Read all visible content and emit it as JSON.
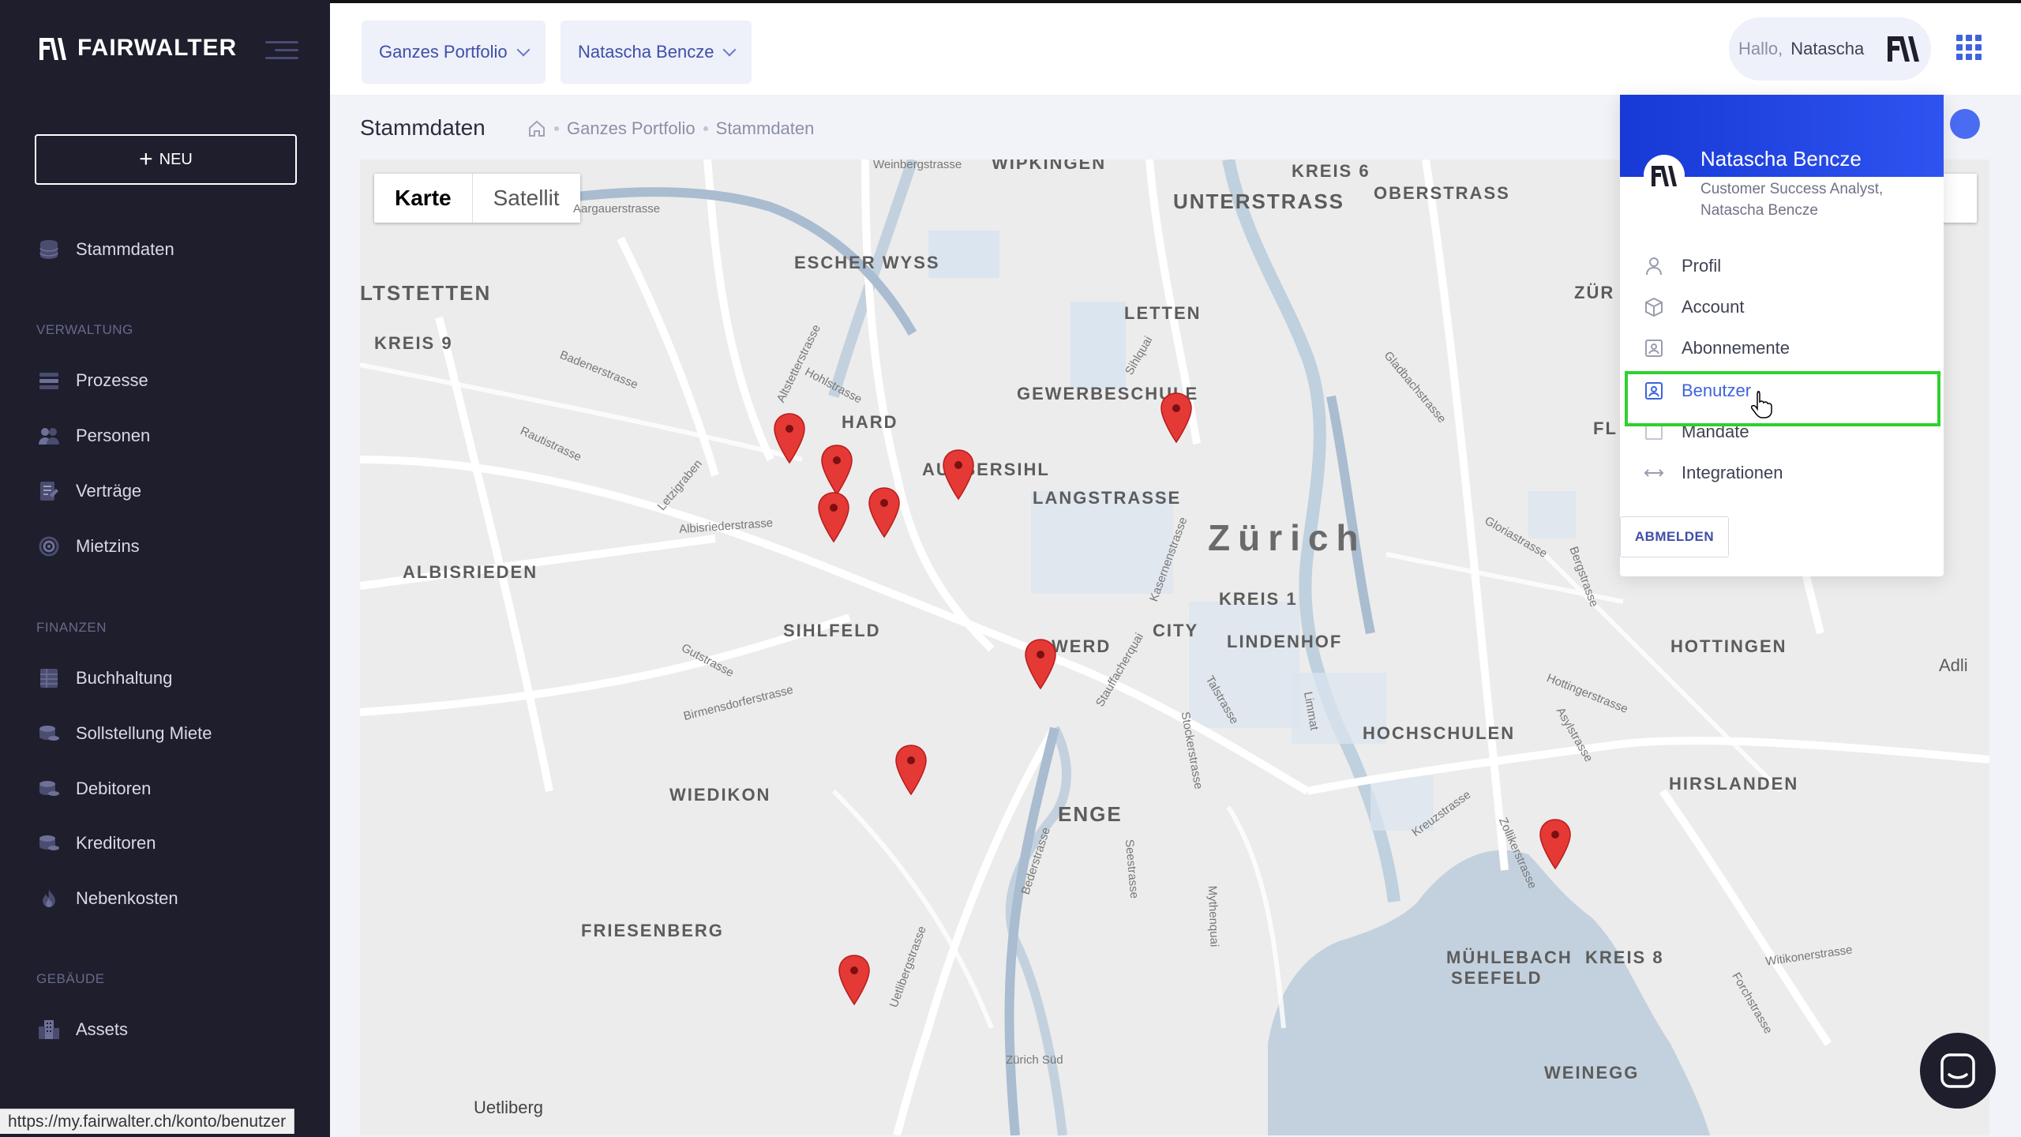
{
  "app": {
    "brand": "FAIRWALTER",
    "status_url": "https://my.fairwalter.ch/konto/benutzer"
  },
  "sidebar": {
    "new_label": "NEU",
    "items": [
      {
        "label": "Stammdaten",
        "icon": "database-icon"
      }
    ],
    "sections": [
      {
        "title": "VERWALTUNG",
        "items": [
          {
            "label": "Prozesse",
            "icon": "list-icon"
          },
          {
            "label": "Personen",
            "icon": "people-icon"
          },
          {
            "label": "Verträge",
            "icon": "contract-icon"
          },
          {
            "label": "Mietzins",
            "icon": "target-icon"
          }
        ]
      },
      {
        "title": "FINANZEN",
        "items": [
          {
            "label": "Buchhaltung",
            "icon": "ledger-icon"
          },
          {
            "label": "Sollstellung Miete",
            "icon": "coins-icon"
          },
          {
            "label": "Debitoren",
            "icon": "coins-icon"
          },
          {
            "label": "Kreditoren",
            "icon": "coins-icon"
          },
          {
            "label": "Nebenkosten",
            "icon": "flame-icon"
          }
        ]
      },
      {
        "title": "GEBÄUDE",
        "items": [
          {
            "label": "Assets",
            "icon": "buildings-icon"
          }
        ]
      }
    ]
  },
  "topbar": {
    "portfolio_select": "Ganzes Portfolio",
    "user_select": "Natascha Bencze",
    "greeting": "Hallo,",
    "user_first_name": "Natascha"
  },
  "page": {
    "title": "Stammdaten",
    "breadcrumb": [
      "Ganzes Portfolio",
      "Stammdaten"
    ]
  },
  "map": {
    "type_buttons": [
      "Karte",
      "Satellit"
    ],
    "active_type": "Karte",
    "districts": [
      "WIPKINGEN",
      "KREIS 6",
      "OBERSTRASS",
      "UNTERSTRASS",
      "ESCHER WYSS",
      "LTSTETTEN",
      "KREIS 9",
      "LETTEN",
      "ZÜR",
      "GEWERBESCHULE",
      "HARD",
      "AUSSERSIHL",
      "LANGSTRASSE",
      "ALBISRIEDEN",
      "Zürich",
      "KREIS 1",
      "CITY",
      "LINDENHOF",
      "SIHLFELD",
      "WERD",
      "HOTTINGEN",
      "HOCHSCHULEN",
      "WIEDIKON",
      "ENGE",
      "HIRSLANDEN",
      "FRIESENBERG",
      "MÜHLEBACH",
      "KREIS 8",
      "SEEFELD",
      "WEINEGG",
      "FL",
      "Adli"
    ],
    "streets": [
      "Weinbergstrasse",
      "Aargauerstrasse",
      "Badenerstrasse",
      "Hohlstrasse",
      "Rautistrasse",
      "Albisriederstrasse",
      "Letzigraben",
      "Gutstrasse",
      "Birmensdorferstrasse",
      "Kasernenstrasse",
      "Stauffacherquai",
      "Talstrasse",
      "Stockerstrasse",
      "Seestrasse",
      "Mythenquai",
      "Bederstrasse",
      "Uetlibergstrasse",
      "Zürich Süd",
      "Uetliberg",
      "Limmat",
      "Gloriastrasse",
      "Bergstrasse",
      "Hottingerstrasse",
      "Asylstrasse",
      "Kreuzstrasse",
      "Zollikerstrasse",
      "Witikonerstrasse",
      "Forchstrasse",
      "Gladbachstrasse",
      "Sihlquai",
      "Altstetterstrasse"
    ],
    "pin_count": 11
  },
  "user_menu": {
    "name": "Natascha Bencze",
    "role": "Customer Success Analyst, Natascha Bencze",
    "items": [
      {
        "label": "Profil",
        "icon": "user-icon"
      },
      {
        "label": "Account",
        "icon": "box-icon"
      },
      {
        "label": "Abonnemente",
        "icon": "subscription-icon"
      },
      {
        "label": "Benutzer",
        "icon": "users-card-icon"
      },
      {
        "label": "Mandate",
        "icon": "folder-icon"
      },
      {
        "label": "Integrationen",
        "icon": "link-arrows-icon"
      }
    ],
    "active_item": "Benutzer",
    "logout_label": "ABMELDEN"
  },
  "colors": {
    "sidebar_bg": "#1e1e2d",
    "accent": "#3e4fa8",
    "highlight": "#2fd12f",
    "pin": "#e53935"
  }
}
